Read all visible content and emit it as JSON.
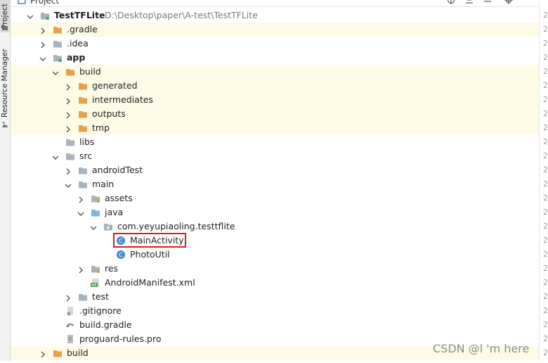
{
  "left_strip": {
    "tabs": [
      "Project",
      "Resource Manager"
    ]
  },
  "header": {
    "title": "Project"
  },
  "tree": [
    {
      "label": "TestTFLite",
      "path": "D:\\Desktop\\paper\\A-test\\TestTFLite",
      "depth": 0,
      "expanded": true,
      "icon": "module-folder-icon",
      "bold": true,
      "highlight": false
    },
    {
      "label": ".gradle",
      "depth": 1,
      "expanded": false,
      "icon": "orange-folder-icon",
      "highlight": true
    },
    {
      "label": ".idea",
      "depth": 1,
      "expanded": false,
      "icon": "gray-folder-icon",
      "highlight": false
    },
    {
      "label": "app",
      "depth": 1,
      "expanded": true,
      "icon": "module-folder-icon",
      "bold": true,
      "highlight": false
    },
    {
      "label": "build",
      "depth": 2,
      "expanded": true,
      "icon": "orange-folder-icon",
      "highlight": true
    },
    {
      "label": "generated",
      "depth": 3,
      "expanded": false,
      "icon": "orange-folder-icon",
      "highlight": true
    },
    {
      "label": "intermediates",
      "depth": 3,
      "expanded": false,
      "icon": "orange-folder-icon",
      "highlight": true
    },
    {
      "label": "outputs",
      "depth": 3,
      "expanded": false,
      "icon": "orange-folder-icon",
      "highlight": true
    },
    {
      "label": "tmp",
      "depth": 3,
      "expanded": false,
      "icon": "orange-folder-icon",
      "highlight": true
    },
    {
      "label": "libs",
      "depth": 2,
      "expanded": null,
      "icon": "gray-folder-icon",
      "highlight": false
    },
    {
      "label": "src",
      "depth": 2,
      "expanded": true,
      "icon": "gray-folder-icon",
      "highlight": false
    },
    {
      "label": "androidTest",
      "depth": 3,
      "expanded": false,
      "icon": "gray-folder-icon",
      "highlight": false
    },
    {
      "label": "main",
      "depth": 3,
      "expanded": true,
      "icon": "gray-folder-icon",
      "highlight": false
    },
    {
      "label": "assets",
      "depth": 4,
      "expanded": false,
      "icon": "assets-folder-icon",
      "highlight": false
    },
    {
      "label": "java",
      "depth": 4,
      "expanded": true,
      "icon": "blue-folder-icon",
      "highlight": false
    },
    {
      "label": "com.yeyupiaoling.testtflite",
      "depth": 5,
      "expanded": true,
      "icon": "package-icon",
      "highlight": false
    },
    {
      "label": "MainActivity",
      "depth": 6,
      "expanded": null,
      "icon": "class-icon",
      "highlight": false
    },
    {
      "label": "PhotoUtil",
      "depth": 6,
      "expanded": null,
      "icon": "class-icon",
      "highlight": false
    },
    {
      "label": "res",
      "depth": 4,
      "expanded": false,
      "icon": "res-folder-icon",
      "highlight": false
    },
    {
      "label": "AndroidManifest.xml",
      "depth": 4,
      "expanded": null,
      "icon": "manifest-icon",
      "highlight": false
    },
    {
      "label": "test",
      "depth": 3,
      "expanded": false,
      "icon": "gray-folder-icon",
      "highlight": false
    },
    {
      "label": ".gitignore",
      "depth": 2,
      "expanded": null,
      "icon": "gitignore-icon",
      "highlight": false
    },
    {
      "label": "build.gradle",
      "depth": 2,
      "expanded": null,
      "icon": "gradle-icon",
      "highlight": false
    },
    {
      "label": "proguard-rules.pro",
      "depth": 2,
      "expanded": null,
      "icon": "file-icon",
      "highlight": false
    },
    {
      "label": "build",
      "depth": 1,
      "expanded": false,
      "icon": "orange-folder-icon",
      "highlight": true
    }
  ],
  "gutter": {
    "line_numbers": [
      "2",
      "2",
      "2",
      "2",
      "2",
      "2",
      "2",
      "2",
      "2",
      "2",
      "2",
      "2",
      "2",
      "2",
      "2",
      "2",
      "2",
      "2",
      "2",
      "2",
      "2",
      "2",
      "2",
      "2",
      "2"
    ]
  },
  "watermark": "CSDN @l 'm here",
  "colors": {
    "highlight_row": "#fdfbe6",
    "orange_folder": "#e8a04a",
    "gray_folder": "#a9b3bd",
    "blue_folder": "#7fb6e6",
    "selection_box": "#e01a1a",
    "class_icon": "#3d8fd1"
  }
}
